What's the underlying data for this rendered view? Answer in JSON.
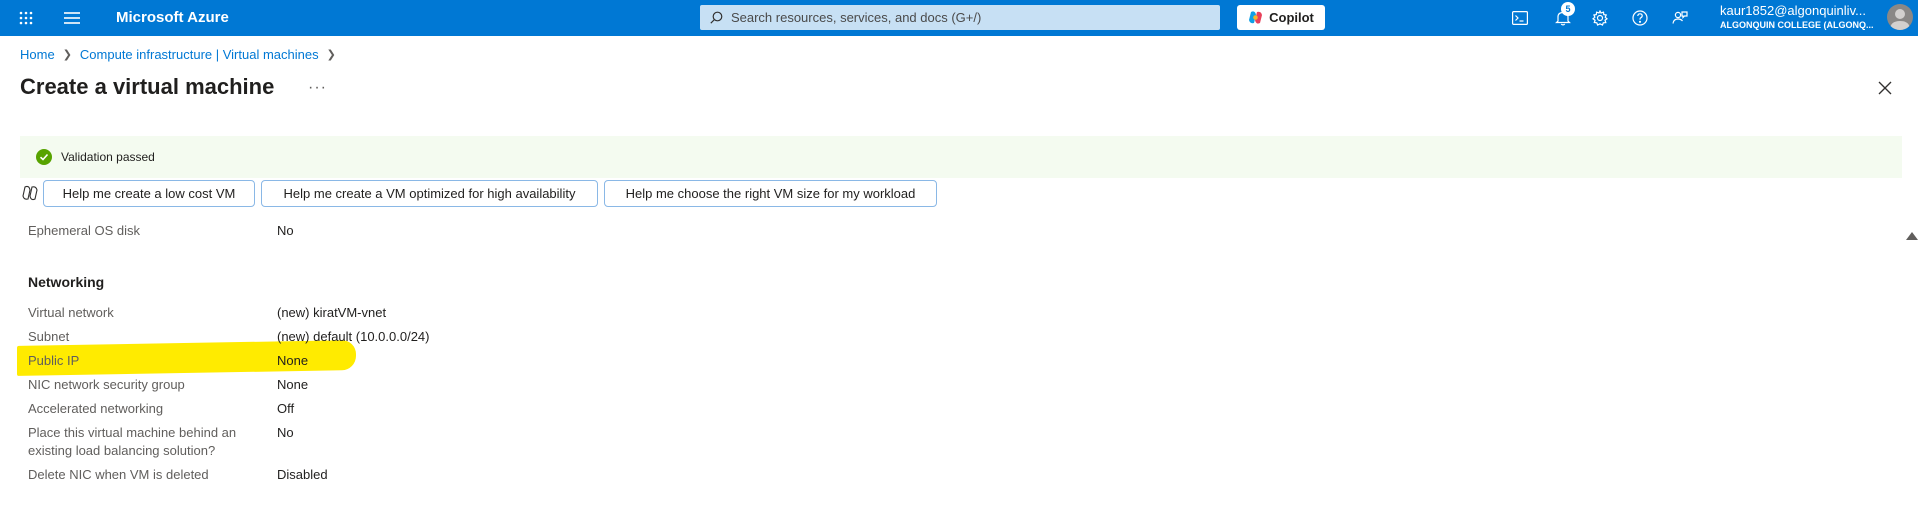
{
  "topbar": {
    "brand": "Microsoft Azure",
    "search_placeholder": "Search resources, services, and docs (G+/)",
    "copilot_label": "Copilot",
    "notification_count": "5",
    "user": "kaur1852@algonquinliv...",
    "org": "ALGONQUIN COLLEGE (ALGONQ..."
  },
  "breadcrumb": {
    "home": "Home",
    "compute": "Compute infrastructure | Virtual machines"
  },
  "page": {
    "title": "Create a virtual machine",
    "more": "···"
  },
  "validation": {
    "message": "Validation passed"
  },
  "suggestions": [
    "Help me create a low cost VM",
    "Help me create a VM optimized for high availability",
    "Help me choose the right VM size for my workload"
  ],
  "disk": {
    "ephemeral_label": "Ephemeral OS disk",
    "ephemeral_value": "No"
  },
  "networking": {
    "title": "Networking",
    "rows": [
      {
        "label": "Virtual network",
        "value": "(new) kiratVM-vnet"
      },
      {
        "label": "Subnet",
        "value": "(new) default (10.0.0.0/24)"
      },
      {
        "label": "Public IP",
        "value": "None"
      },
      {
        "label": "NIC network security group",
        "value": "None"
      },
      {
        "label": "Accelerated networking",
        "value": "Off"
      },
      {
        "label_line1": "Place this virtual machine behind an",
        "label_line2": "existing load balancing solution?",
        "value": "No"
      },
      {
        "label": "Delete NIC when VM is deleted",
        "value": "Disabled"
      }
    ]
  },
  "colors": {
    "accent": "#0078d4",
    "highlight": "#ffeb00",
    "success": "#57a300"
  }
}
